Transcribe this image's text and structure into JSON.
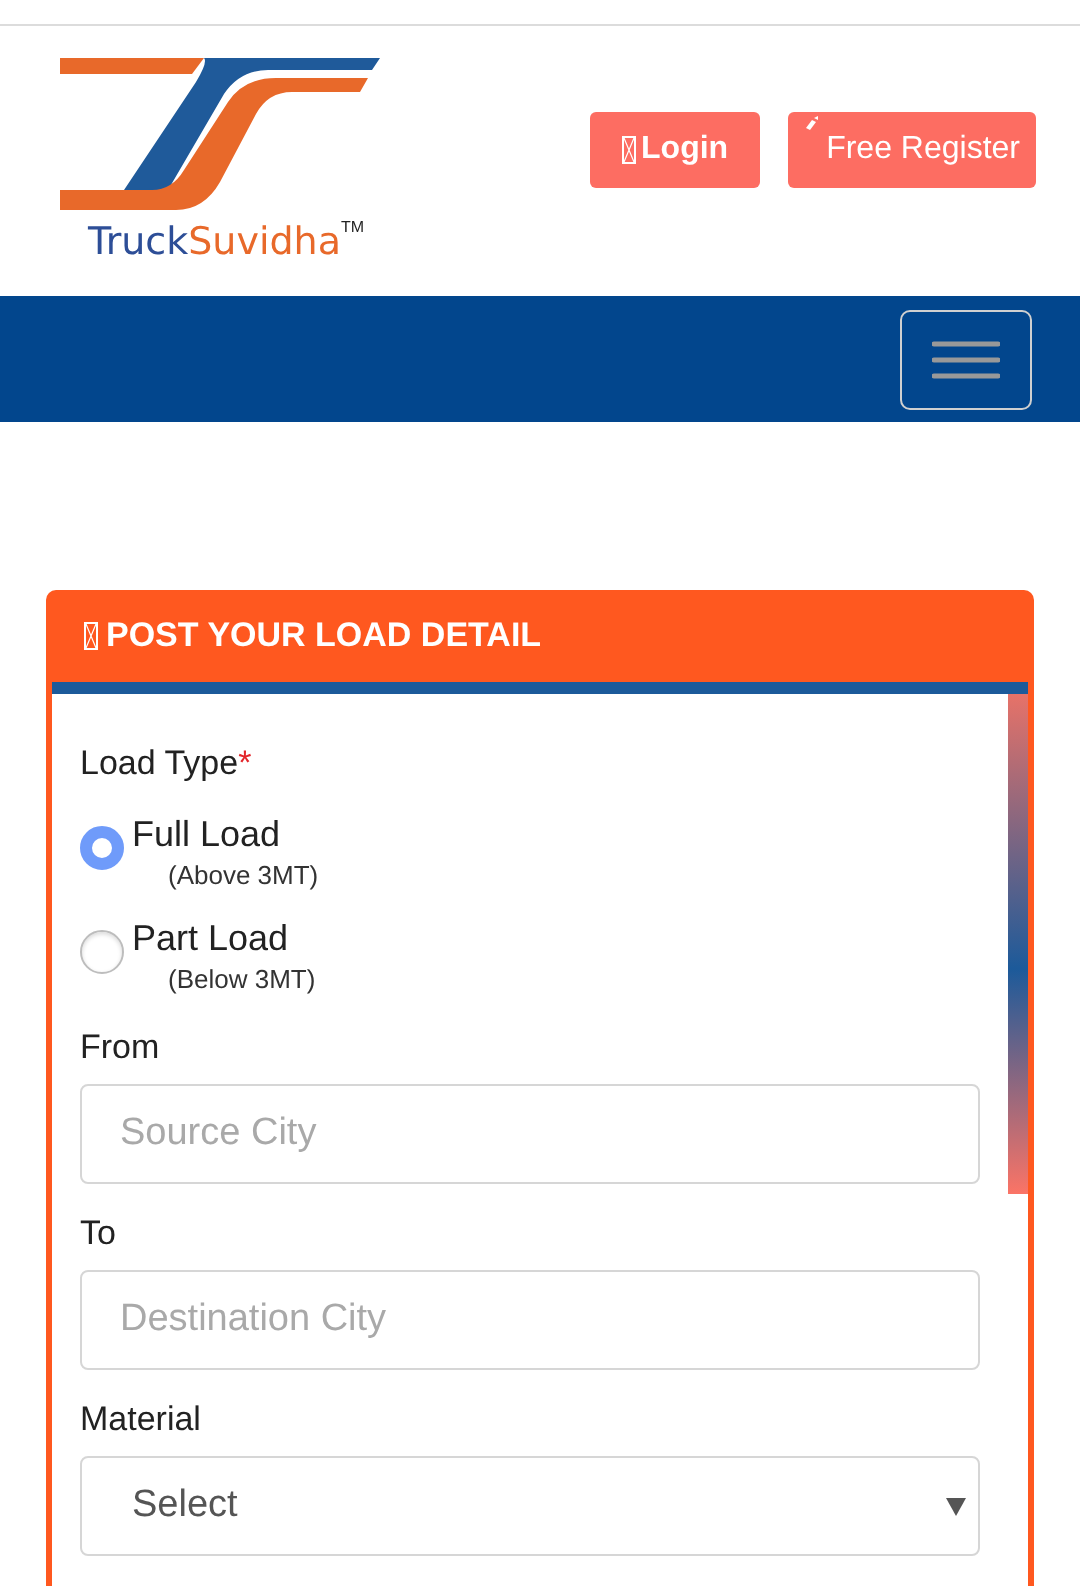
{
  "header": {
    "logo": {
      "brand_first": "Truck",
      "brand_second": "Suvidha",
      "trademark": "TM"
    },
    "buttons": [
      {
        "kind": "login",
        "label": "Login"
      },
      {
        "kind": "register",
        "label": "Free Register"
      }
    ]
  },
  "navbar": {
    "menu_expanded": false
  },
  "form": {
    "title": "POST YOUR LOAD DETAIL",
    "load_type": {
      "label": "Load Type",
      "required_mark": "*",
      "options": [
        {
          "label": "Full Load",
          "note": "(Above 3MT)",
          "selected": true
        },
        {
          "label": "Part Load",
          "note": "(Below 3MT)",
          "selected": false
        }
      ]
    },
    "fields": [
      {
        "kind": "text",
        "label": "From",
        "placeholder": "Source City"
      },
      {
        "kind": "text",
        "label": "To",
        "placeholder": "Destination City"
      },
      {
        "kind": "select",
        "label": "Material",
        "value": "Select"
      }
    ]
  }
}
